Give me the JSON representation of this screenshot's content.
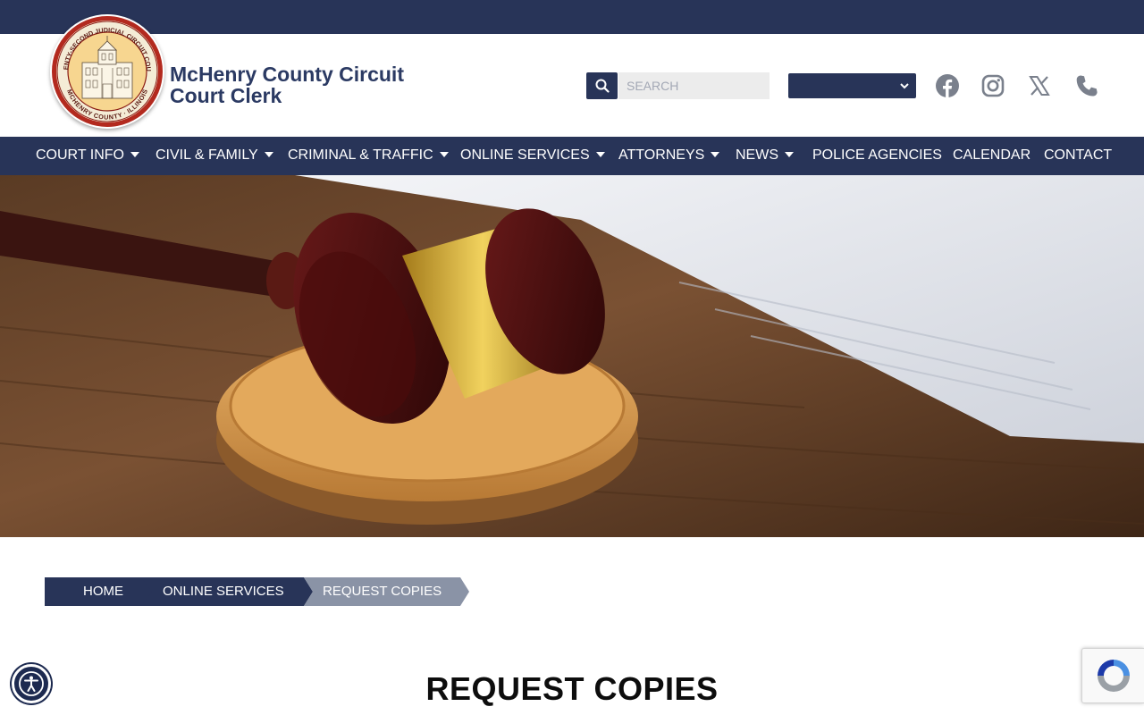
{
  "header": {
    "title": "McHenry County Circuit Court Clerk",
    "title_line1": "McHenry County Circuit",
    "title_line2": "Court Clerk",
    "logo": {
      "name": "court-seal-logo",
      "seal_top_text": "TWENTY-SECOND JUDICIAL CIRCUIT COURT",
      "seal_bottom_text": "MCHENRY COUNTY · ILLINOIS"
    },
    "search": {
      "placeholder": "SEARCH",
      "icon": "search-icon"
    },
    "language_select": {
      "selected": ""
    },
    "social": [
      {
        "name": "facebook-icon"
      },
      {
        "name": "instagram-icon"
      },
      {
        "name": "x-icon"
      },
      {
        "name": "phone-icon"
      }
    ]
  },
  "nav": {
    "items": [
      {
        "label": "COURT INFO",
        "dropdown": true
      },
      {
        "label": "CIVIL & FAMILY",
        "dropdown": true
      },
      {
        "label": "CRIMINAL & TRAFFIC",
        "dropdown": true
      },
      {
        "label": "ONLINE SERVICES",
        "dropdown": true
      },
      {
        "label": "ATTORNEYS",
        "dropdown": true
      },
      {
        "label": "NEWS",
        "dropdown": true
      },
      {
        "label": "POLICE AGENCIES",
        "dropdown": false
      },
      {
        "label": "CALENDAR",
        "dropdown": false
      },
      {
        "label": "CONTACT",
        "dropdown": false
      }
    ]
  },
  "hero": {
    "image": "gavel-on-sound-block-photo"
  },
  "breadcrumb": {
    "items": [
      "HOME",
      "ONLINE SERVICES",
      "REQUEST COPIES"
    ]
  },
  "main": {
    "title": "REQUEST COPIES"
  },
  "widgets": {
    "accessibility": "accessibility-icon",
    "recaptcha": "recaptcha-badge"
  },
  "colors": {
    "navy": "#283458",
    "title_navy": "#2b3a63",
    "crumb_active": "#8a93a6",
    "search_bg": "#ececec"
  }
}
